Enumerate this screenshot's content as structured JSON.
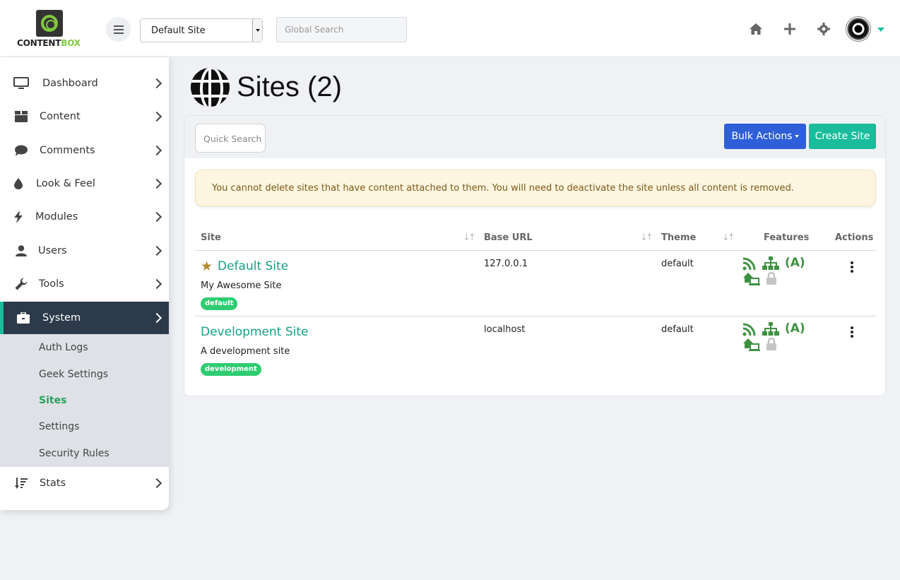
{
  "brand": {
    "logo_text_1": "CONTENT",
    "logo_text_2": "BOX"
  },
  "topbar": {
    "site_selector": "Default Site",
    "search_placeholder": "Global Search"
  },
  "sidebar": {
    "items": [
      {
        "label": "Dashboard",
        "icon": "monitor-icon"
      },
      {
        "label": "Content",
        "icon": "box-icon"
      },
      {
        "label": "Comments",
        "icon": "comment-icon"
      },
      {
        "label": "Look & Feel",
        "icon": "droplet-icon"
      },
      {
        "label": "Modules",
        "icon": "bolt-icon"
      },
      {
        "label": "Users",
        "icon": "user-icon"
      },
      {
        "label": "Tools",
        "icon": "wrench-icon"
      },
      {
        "label": "System",
        "icon": "briefcase-icon"
      },
      {
        "label": "Stats",
        "icon": "sort-amount-icon"
      }
    ],
    "system_submenu": [
      "Auth Logs",
      "Geek Settings",
      "Sites",
      "Settings",
      "Security Rules"
    ]
  },
  "page": {
    "title": "Sites (2)",
    "quick_search_placeholder": "Quick Search",
    "bulk_actions_label": "Bulk Actions",
    "create_site_label": "Create Site",
    "alert_text": "You cannot delete sites that have content attached to them. You will need to deactivate the site unless all content is removed."
  },
  "table": {
    "columns": [
      "Site",
      "Base URL",
      "Theme",
      "Features",
      "Actions"
    ],
    "rows": [
      {
        "name": "Default Site",
        "description": "My Awesome Site",
        "slug": "default",
        "base_url": "127.0.0.1",
        "theme": "default",
        "is_default": true
      },
      {
        "name": "Development Site",
        "description": "A development site",
        "slug": "development",
        "base_url": "localhost",
        "theme": "default",
        "is_default": false
      }
    ]
  },
  "colors": {
    "accent": "#1abc9c",
    "primary_button": "#2f5fd8",
    "active_nav_bg": "#2c3a4a",
    "feature_green": "#3f9142"
  }
}
